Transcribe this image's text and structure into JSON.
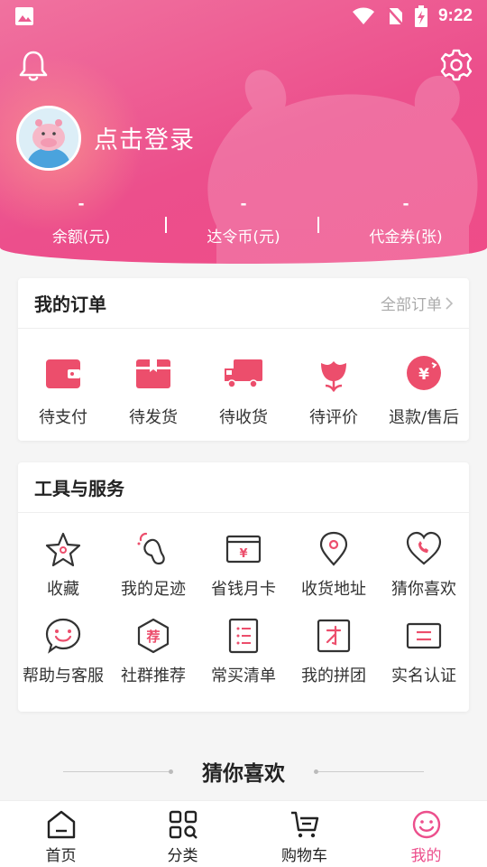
{
  "status": {
    "time": "9:22"
  },
  "colors": {
    "brand_pink": "#ec4f8c",
    "header_gradient_start": "#f0729f",
    "icon_red": "#ec4e6c"
  },
  "header": {
    "bell_icon": "bell-icon",
    "settings_icon": "gear-icon",
    "login_text": "点击登录",
    "stats": [
      {
        "value": "-",
        "label": "余额(元)"
      },
      {
        "value": "-",
        "label": "达令币(元)"
      },
      {
        "value": "-",
        "label": "代金券(张)"
      }
    ]
  },
  "orders": {
    "title": "我的订单",
    "all_link": "全部订单",
    "items": [
      {
        "label": "待支付",
        "icon": "wallet-icon"
      },
      {
        "label": "待发货",
        "icon": "package-icon"
      },
      {
        "label": "待收货",
        "icon": "truck-icon"
      },
      {
        "label": "待评价",
        "icon": "flower-icon"
      },
      {
        "label": "退款/售后",
        "icon": "refund-icon"
      }
    ]
  },
  "tools": {
    "title": "工具与服务",
    "items": [
      {
        "label": "收藏",
        "icon": "star-icon"
      },
      {
        "label": "我的足迹",
        "icon": "footprint-icon"
      },
      {
        "label": "省钱月卡",
        "icon": "money-card-icon"
      },
      {
        "label": "收货地址",
        "icon": "location-icon"
      },
      {
        "label": "猜你喜欢",
        "icon": "heart-phone-icon"
      },
      {
        "label": "帮助与客服",
        "icon": "smile-chat-icon"
      },
      {
        "label": "社群推荐",
        "icon": "recommend-hexagon-icon"
      },
      {
        "label": "常买清单",
        "icon": "list-icon"
      },
      {
        "label": "我的拼团",
        "icon": "group-buy-icon"
      },
      {
        "label": "实名认证",
        "icon": "id-card-icon"
      }
    ],
    "recommend_glyph": "荐",
    "money_glyph": "¥"
  },
  "guess": {
    "title": "猜你喜欢"
  },
  "tabbar": {
    "items": [
      {
        "label": "首页",
        "icon": "home-icon"
      },
      {
        "label": "分类",
        "icon": "category-icon"
      },
      {
        "label": "购物车",
        "icon": "cart-icon"
      },
      {
        "label": "我的",
        "icon": "profile-smile-icon"
      }
    ],
    "active": "我的"
  }
}
